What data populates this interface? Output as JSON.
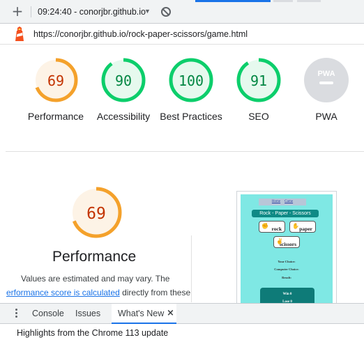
{
  "toolbar": {
    "add_icon": "plus-icon",
    "session_label": "09:24:40 - conorjbr.github.io",
    "dropdown_icon": "caret-down-icon",
    "clear_icon": "no-entry-icon"
  },
  "urlbar": {
    "logo_icon": "lighthouse-icon",
    "url": "https://conorjbr.github.io/rock-paper-scissors/game.html"
  },
  "scores": [
    {
      "label": "Performance",
      "value": "69",
      "fill": 0.69,
      "color": "#f4a12b",
      "track": "#fdf3e6",
      "text": "#c33300"
    },
    {
      "label": "Accessibility",
      "value": "90",
      "fill": 0.9,
      "color": "#0cce6b",
      "track": "#e6f9ee",
      "text": "#018642"
    },
    {
      "label": "Best Practices",
      "value": "100",
      "fill": 1.0,
      "color": "#0cce6b",
      "track": "#e6f9ee",
      "text": "#018642"
    },
    {
      "label": "SEO",
      "value": "91",
      "fill": 0.91,
      "color": "#0cce6b",
      "track": "#e6f9ee",
      "text": "#018642"
    },
    {
      "label": "PWA",
      "badge": "PWA",
      "color": "#dadce0"
    }
  ],
  "performance": {
    "score": "69",
    "fill": 0.69,
    "title": "Performance",
    "desc_line1": "Values are estimated and may vary. The",
    "link_text": "erformance score is calculated",
    "desc_tail": " directly from these"
  },
  "thumbnail": {
    "nav_home": "Home",
    "nav_game": "Game",
    "banner": "Rock - Paper - Scissors",
    "rock": "rock",
    "paper": "paper",
    "scissors": "scissors",
    "your_choice": "Your Choice:",
    "computer_choice": "Computer Choice:",
    "result": "Result:",
    "win": "Win 0",
    "lose": "Lose 0"
  },
  "drawer": {
    "menu_icon": "more-vertical-icon",
    "tabs": [
      "Console",
      "Issues",
      "What's New"
    ],
    "close_symbol": "×",
    "message": "Highlights from the Chrome 113 update"
  }
}
